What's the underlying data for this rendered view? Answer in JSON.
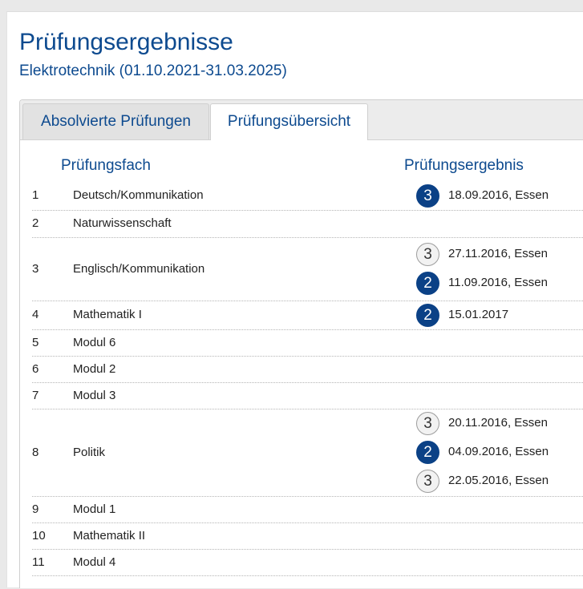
{
  "page": {
    "title": "Prüfungsergebnisse",
    "subtitle": "Elektrotechnik (01.10.2021-31.03.2025)"
  },
  "tabs": [
    {
      "label": "Absolvierte Prüfungen",
      "active": false
    },
    {
      "label": "Prüfungsübersicht",
      "active": true
    }
  ],
  "table": {
    "headers": {
      "subject": "Prüfungsfach",
      "result": "Prüfungsergebnis"
    },
    "rows": [
      {
        "num": "1",
        "subject": "Deutsch/Kommunikation",
        "results": [
          {
            "grade": "3",
            "status": "passed",
            "text": "18.09.2016, Essen"
          }
        ]
      },
      {
        "num": "2",
        "subject": "Naturwissenschaft",
        "results": []
      },
      {
        "num": "3",
        "subject": "Englisch/Kommunikation",
        "results": [
          {
            "grade": "3",
            "status": "failed",
            "text": "27.11.2016, Essen"
          },
          {
            "grade": "2",
            "status": "passed",
            "text": "11.09.2016, Essen"
          }
        ]
      },
      {
        "num": "4",
        "subject": "Mathematik I",
        "results": [
          {
            "grade": "2",
            "status": "passed",
            "text": "15.01.2017"
          }
        ]
      },
      {
        "num": "5",
        "subject": "Modul 6",
        "results": []
      },
      {
        "num": "6",
        "subject": "Modul 2",
        "results": []
      },
      {
        "num": "7",
        "subject": "Modul 3",
        "results": []
      },
      {
        "num": "8",
        "subject": "Politik",
        "results": [
          {
            "grade": "3",
            "status": "failed",
            "text": "20.11.2016, Essen"
          },
          {
            "grade": "2",
            "status": "passed",
            "text": "04.09.2016, Essen"
          },
          {
            "grade": "3",
            "status": "failed",
            "text": "22.05.2016, Essen"
          }
        ]
      },
      {
        "num": "9",
        "subject": "Modul 1",
        "results": []
      },
      {
        "num": "10",
        "subject": "Mathematik II",
        "results": []
      },
      {
        "num": "11",
        "subject": "Modul 4",
        "results": []
      }
    ]
  },
  "colors": {
    "accent": "#0d4a8f",
    "grade_passed": "#0b4186",
    "grade_failed": "#f2f2f2"
  }
}
